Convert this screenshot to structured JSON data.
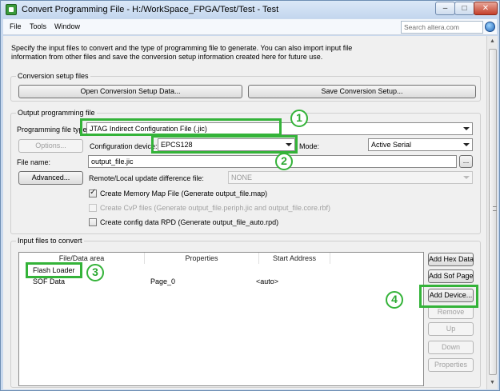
{
  "window": {
    "title": "Convert Programming File - H:/WorkSpace_FPGA/Test/Test - Test",
    "min_glyph": "–",
    "max_glyph": "□",
    "close_glyph": "✕"
  },
  "menu": {
    "file": "File",
    "tools": "Tools",
    "window": "Window",
    "search_placeholder": "Search altera.com"
  },
  "description": "Specify the input files to convert and the type of programming file to generate. You can also import input file information from other files and save the conversion setup information created here for future use.",
  "conversion_setup": {
    "label": "Conversion setup files",
    "open_button": "Open Conversion Setup Data...",
    "save_button": "Save Conversion Setup..."
  },
  "output": {
    "label": "Output programming file",
    "type_label": "Programming file type:",
    "type_value": "JTAG Indirect Configuration File (.jic)",
    "options_button": "Options...",
    "config_device_label": "Configuration device:",
    "config_device_value": "EPCS128",
    "mode_label": "Mode:",
    "mode_value": "Active Serial",
    "file_name_label": "File name:",
    "file_name_value": "output_file.jic",
    "browse_button": "...",
    "advanced_button": "Advanced...",
    "remote_label": "Remote/Local update difference file:",
    "remote_value": "NONE",
    "cb_memory_map": "Create Memory Map File (Generate output_file.map)",
    "cb_cvp": "Create CvP files (Generate output_file.periph.jic and output_file.core.rbf)",
    "cb_rpd": "Create config data RPD (Generate output_file_auto.rpd)"
  },
  "input": {
    "label": "Input files to convert",
    "columns": [
      "File/Data area",
      "Properties",
      "Start Address"
    ],
    "rows": [
      {
        "name": "Flash Loader",
        "properties": "",
        "address": ""
      },
      {
        "name": "SOF Data",
        "properties": "Page_0",
        "address": "<auto>"
      }
    ],
    "buttons": {
      "add_hex": "Add Hex Data",
      "add_sof": "Add Sof Page",
      "add_device": "Add Device...",
      "remove": "Remove",
      "up": "Up",
      "down": "Down",
      "properties": "Properties"
    }
  },
  "annotations": [
    "1",
    "2",
    "3",
    "4"
  ],
  "colors": {
    "annotation_green": "#34b339",
    "titlebar": "#c9d9ee"
  }
}
